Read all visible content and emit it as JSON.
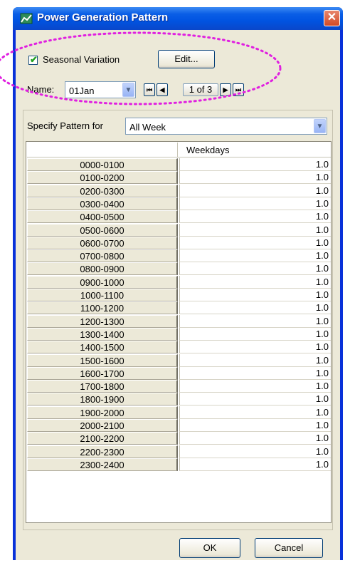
{
  "window": {
    "title": "Power Generation Pattern",
    "close_glyph": "✕"
  },
  "top": {
    "seasonal_label": "Seasonal Variation",
    "seasonal_checked": true,
    "edit_label": "Edit...",
    "name_label": "Name:",
    "name_value": "01Jan",
    "nav": {
      "first": "⏮",
      "prev": "◀",
      "page": "1 of 3",
      "next": "▶",
      "last": "⏭"
    }
  },
  "specify": {
    "label": "Specify Pattern for",
    "value": "All Week"
  },
  "table": {
    "column_header": "Weekdays",
    "rows": [
      {
        "hour": "0000-0100",
        "value": "1.0"
      },
      {
        "hour": "0100-0200",
        "value": "1.0"
      },
      {
        "hour": "0200-0300",
        "value": "1.0"
      },
      {
        "hour": "0300-0400",
        "value": "1.0"
      },
      {
        "hour": "0400-0500",
        "value": "1.0"
      },
      {
        "hour": "0500-0600",
        "value": "1.0"
      },
      {
        "hour": "0600-0700",
        "value": "1.0"
      },
      {
        "hour": "0700-0800",
        "value": "1.0"
      },
      {
        "hour": "0800-0900",
        "value": "1.0"
      },
      {
        "hour": "0900-1000",
        "value": "1.0"
      },
      {
        "hour": "1000-1100",
        "value": "1.0"
      },
      {
        "hour": "1100-1200",
        "value": "1.0"
      },
      {
        "hour": "1200-1300",
        "value": "1.0"
      },
      {
        "hour": "1300-1400",
        "value": "1.0"
      },
      {
        "hour": "1400-1500",
        "value": "1.0"
      },
      {
        "hour": "1500-1600",
        "value": "1.0"
      },
      {
        "hour": "1600-1700",
        "value": "1.0"
      },
      {
        "hour": "1700-1800",
        "value": "1.0"
      },
      {
        "hour": "1800-1900",
        "value": "1.0"
      },
      {
        "hour": "1900-2000",
        "value": "1.0"
      },
      {
        "hour": "2000-2100",
        "value": "1.0"
      },
      {
        "hour": "2100-2200",
        "value": "1.0"
      },
      {
        "hour": "2200-2300",
        "value": "1.0"
      },
      {
        "hour": "2300-2400",
        "value": "1.0"
      }
    ]
  },
  "buttons": {
    "ok": "OK",
    "cancel": "Cancel"
  },
  "colors": {
    "highlight_dots": "#e020e0",
    "title_bar": "#0a5ee6",
    "dialog_bg": "#ece9d8"
  }
}
